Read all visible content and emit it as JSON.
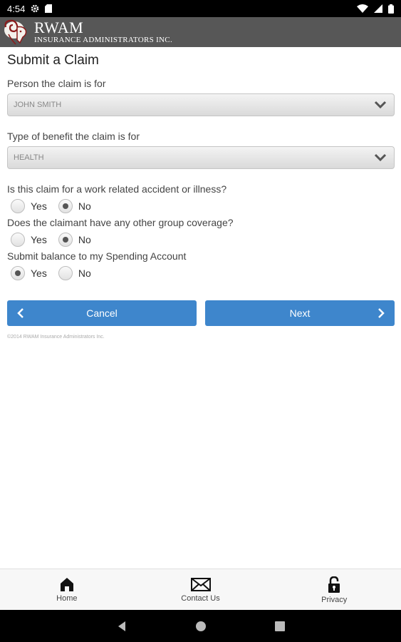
{
  "status_bar": {
    "time": "4:54",
    "left_icons": [
      "gear-icon",
      "sd-card-icon"
    ],
    "right_icons": [
      "wifi-icon",
      "signal-icon",
      "battery-icon"
    ]
  },
  "header": {
    "brand_name": "RWAM",
    "brand_subtitle": "INSURANCE ADMINISTRATORS INC.",
    "background_color": "#575757"
  },
  "form": {
    "title": "Submit a Claim",
    "person": {
      "label": "Person the claim is for",
      "value": "JOHN SMITH"
    },
    "benefit_type": {
      "label": "Type of benefit the claim is for",
      "value": "HEALTH"
    },
    "questions": [
      {
        "label": "Is this claim for a work related accident or illness?",
        "options": [
          "Yes",
          "No"
        ],
        "selected": "No"
      },
      {
        "label": "Does the claimant have any other group coverage?",
        "options": [
          "Yes",
          "No"
        ],
        "selected": "No"
      },
      {
        "label": "Submit balance to my Spending Account",
        "options": [
          "Yes",
          "No"
        ],
        "selected": "Yes"
      }
    ],
    "cancel_label": "Cancel",
    "next_label": "Next",
    "button_color": "#3e86cc"
  },
  "copyright": "©2014 RWAM Insurance Administrators Inc.",
  "bottom_nav": {
    "home": "Home",
    "contact": "Contact Us",
    "privacy": "Privacy"
  }
}
